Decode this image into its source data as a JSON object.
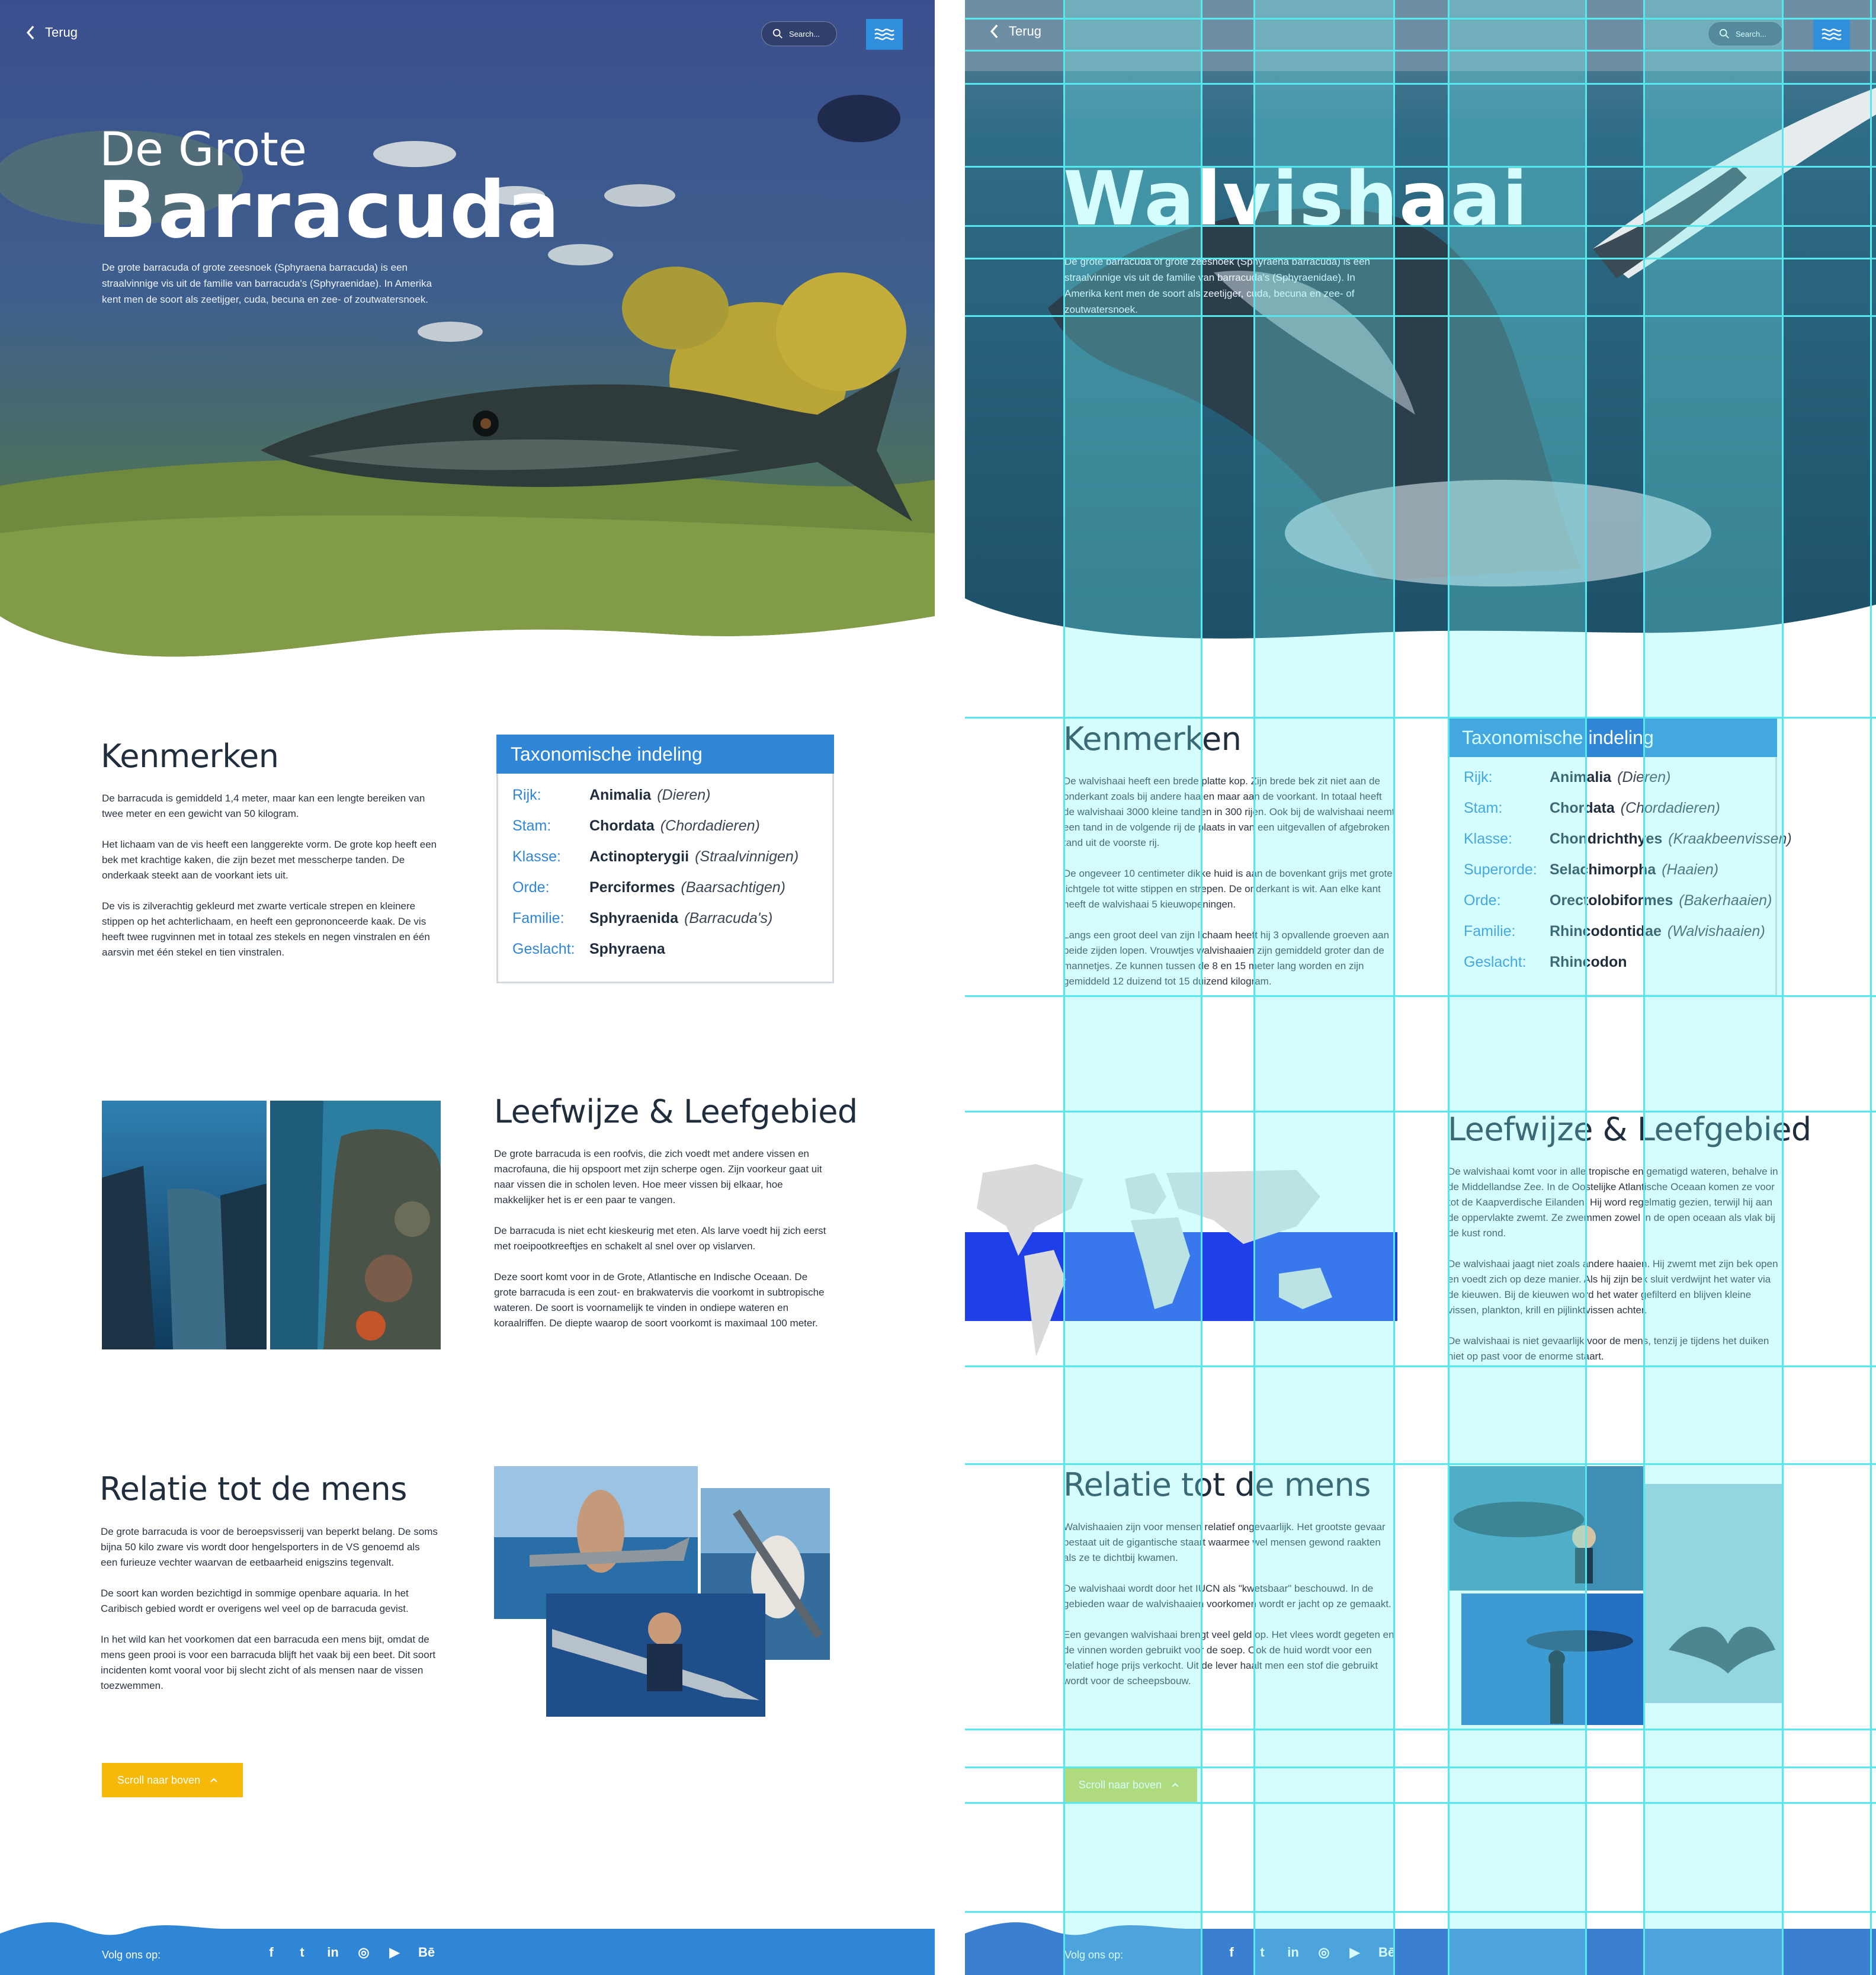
{
  "left": {
    "back_label": "Terug",
    "search_placeholder": "Search...",
    "hero_title_small": "De Grote",
    "hero_title_big": "Barracuda",
    "hero_description": "De grote barracuda of grote zeesnoek (Sphyraena barracuda) is een straalvinnige vis uit de familie van barracuda's (Sphyraenidae). In Amerika kent men de soort als zeetijger, cuda, becuna en zee- of zoutwatersnoek.",
    "kenmerken": {
      "title": "Kenmerken",
      "paragraphs": [
        "De barracuda is gemiddeld 1,4 meter, maar kan een lengte bereiken van twee meter en een gewicht van 50 kilogram.",
        "Het lichaam van de vis heeft een langgerekte vorm. De grote kop heeft een bek met krachtige kaken, die zijn bezet met messcherpe tanden. De onderkaak steekt aan de voorkant iets uit.",
        "De vis is zilverachtig gekleurd met zwarte verticale strepen en kleinere stippen op het achterlichaam, en heeft een geprononceerde kaak. De vis heeft twee rugvinnen met in totaal zes stekels en negen vinstralen en één aarsvin met één stekel en tien vinstralen."
      ]
    },
    "taxonomy": {
      "title": "Taxonomische indeling",
      "rows": [
        {
          "key": "Rijk:",
          "value": "Animalia",
          "common": "(Dieren)"
        },
        {
          "key": "Stam:",
          "value": "Chordata",
          "common": "(Chordadieren)"
        },
        {
          "key": "Klasse:",
          "value": "Actinopterygii",
          "common": "(Straalvinnigen)"
        },
        {
          "key": "Orde:",
          "value": "Perciformes",
          "common": "(Baarsachtigen)"
        },
        {
          "key": "Familie:",
          "value": "Sphyraenida",
          "common": "(Barracuda's)"
        },
        {
          "key": "Geslacht:",
          "value": "Sphyraena",
          "common": ""
        }
      ]
    },
    "leefwijze": {
      "title": "Leefwijze & Leefgebied",
      "paragraphs": [
        "De grote barracuda is een roofvis, die zich voedt met andere vissen en macrofauna, die hij opspoort met zijn scherpe ogen. Zijn voorkeur gaat uit naar vissen die in scholen leven. Hoe meer vissen bij elkaar, hoe makkelijker het is er een paar te vangen.",
        "De barracuda is niet echt kieskeurig met eten. Als larve voedt hij zich eerst met roeipootkreeftjes en schakelt al snel over op vislarven.",
        "Deze soort komt voor in de Grote, Atlantische en Indische Oceaan. De grote barracuda is een zout- en brakwatervis die voorkomt in subtropische wateren. De soort is voornamelijk te vinden in ondiepe wateren en koraalriffen. De diepte waarop de soort voorkomt is maximaal 100 meter."
      ]
    },
    "relatie": {
      "title": "Relatie tot de mens",
      "paragraphs": [
        "De grote barracuda is voor de beroepsvisserij van beperkt belang. De soms bijna 50 kilo zware vis wordt door hengelsporters in de VS genoemd als een furieuze vechter waarvan de eetbaarheid enigszins tegenvalt.",
        "De soort kan worden bezichtigd in sommige openbare aquaria. In het Caribisch gebied wordt er overigens wel veel op de barracuda gevist.",
        "In het wild kan het voorkomen dat een barracuda een mens bijt, omdat de mens geen prooi is voor een barracuda blijft het vaak bij een beet. Dit soort incidenten komt vooral voor bij slecht zicht of als mensen naar de vissen toezwemmen."
      ]
    },
    "scroll_label": "Scroll naar boven",
    "footer_label": "Volg ons op:"
  },
  "right": {
    "back_label": "Terug",
    "search_placeholder": "Search...",
    "hero_title": "Walvishaai",
    "hero_description": "De grote barracuda of grote zeesnoek (Sphyraena barracuda) is een straalvinnige vis uit de familie van barracuda's (Sphyraenidae). In Amerika kent men de soort als zeetijger, cuda, becuna en zee- of zoutwatersnoek.",
    "kenmerken": {
      "title": "Kenmerken",
      "paragraphs": [
        "De walvishaai heeft een brede platte kop. Zijn brede bek zit niet aan de onderkant zoals bij andere haaien maar aan de voorkant. In totaal heeft de walvishaai 3000 kleine tanden in 300 rijen. Ook bij de walvishaai neemt een tand in de volgende rij de plaats in van een uitgevallen of afgebroken tand uit de voorste rij.",
        "De ongeveer 10 centimeter dikke huid is aan de bovenkant grijs met grote lichtgele tot witte stippen en strepen. De onderkant is wit. Aan elke kant heeft de walvishaai 5 kieuwopeningen.",
        "Langs een groot deel van zijn lichaam heeft hij 3 opvallende groeven aan beide zijden lopen. Vrouwtjes walvishaaien zijn gemiddeld groter dan de mannetjes. Ze kunnen tussen de 8 en 15 meter lang worden en zijn gemiddeld 12 duizend tot 15 duizend kilogram."
      ]
    },
    "taxonomy": {
      "title": "Taxonomische indeling",
      "rows": [
        {
          "key": "Rijk:",
          "value": "Animalia",
          "common": "(Dieren)"
        },
        {
          "key": "Stam:",
          "value": "Chordata",
          "common": "(Chordadieren)"
        },
        {
          "key": "Klasse:",
          "value": "Chondrichthyes",
          "common": "(Kraakbeenvissen)"
        },
        {
          "key": "Superorde:",
          "value": "Selachimorpha",
          "common": "(Haaien)"
        },
        {
          "key": "Orde:",
          "value": "Orectolobiformes",
          "common": "(Bakerhaaien)"
        },
        {
          "key": "Familie:",
          "value": "Rhincodontidae",
          "common": "(Walvishaaien)"
        },
        {
          "key": "Geslacht:",
          "value": "Rhincodon",
          "common": ""
        }
      ]
    },
    "leefwijze": {
      "title": "Leefwijze & Leefgebied",
      "paragraphs": [
        "De walvishaai komt voor in alle tropische en gematigd wateren, behalve in de Middellandse Zee. In de Oostelijke Atlantische Oceaan komen ze voor tot de Kaapverdische Eilanden. Hij word regelmatig gezien, terwijl hij aan de oppervlakte zwemt. Ze zwemmen zowel in de open oceaan als vlak bij de kust rond.",
        "De walvishaai jaagt niet zoals andere haaien. Hij zwemt met zijn bek open en voedt zich op deze manier. Als hij zijn bek sluit verdwijnt het water via de kieuwen. Bij de kieuwen word het water gefilterd en blijven kleine vissen, plankton, krill en pijlinktvissen achter.",
        "De walvishaai is niet gevaarlijk voor de mens, tenzij je tijdens het duiken niet op past voor de enorme staart."
      ]
    },
    "relatie": {
      "title": "Relatie tot de mens",
      "paragraphs": [
        "Walvishaaien zijn voor mensen relatief ongevaarlijk. Het grootste gevaar bestaat uit de gigantische staart waarmee wel mensen gewond raakten als ze te dichtbij kwamen.",
        "De walvishaai wordt door het IUCN als \"kwetsbaar\" beschouwd. In de gebieden waar de walvishaaien voorkomen wordt er jacht op ze gemaakt.",
        "Een gevangen walvishaai brengt veel geld op. Het vlees wordt gegeten en de vinnen worden gebruikt voor de soep. Ook de huid wordt voor een relatief hoge prijs verkocht. Uit de lever haalt men een stof die gebruikt wordt voor de scheepsbouw."
      ]
    },
    "scroll_label": "Scroll naar boven",
    "footer_label": "Volg ons op:"
  },
  "social_icons": [
    "facebook-icon",
    "twitter-icon",
    "linkedin-icon",
    "instagram-icon",
    "youtube-icon",
    "behance-icon"
  ],
  "social_glyphs": [
    "f",
    "t",
    "in",
    "◎",
    "▶",
    "Bē"
  ],
  "colors": {
    "accent_blue": "#2f86d6",
    "footer_blue": "#2f86d6",
    "scroll_button": "#f6b90a",
    "grid_overlay": "#55e8ee"
  }
}
